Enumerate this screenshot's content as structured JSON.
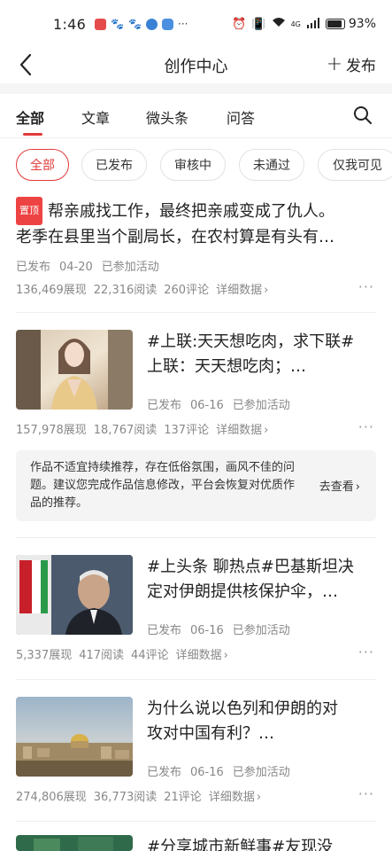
{
  "status_bar": {
    "time": "1:46",
    "notification_more": "···",
    "network": "4G",
    "battery_pct": "93%"
  },
  "header": {
    "title": "创作中心",
    "publish_label": "发布"
  },
  "tabs": [
    {
      "label": "全部",
      "active": true
    },
    {
      "label": "文章",
      "active": false
    },
    {
      "label": "微头条",
      "active": false
    },
    {
      "label": "问答",
      "active": false
    }
  ],
  "chips": [
    {
      "label": "全部",
      "active": true
    },
    {
      "label": "已发布",
      "active": false
    },
    {
      "label": "审核中",
      "active": false
    },
    {
      "label": "未通过",
      "active": false
    },
    {
      "label": "仅我可见",
      "active": false
    }
  ],
  "items": [
    {
      "pin_label": "置顶",
      "title_line1": "帮亲戚找工作，最终把亲戚变成了仇人。",
      "title_line2": "老季在县里当个副局长，在农村算是有头有…",
      "status": "已发布",
      "date": "04-20",
      "activity": "已参加活动",
      "views": "136,469展现",
      "reads": "22,316阅读",
      "comments": "260评论",
      "detail": "详细数据"
    },
    {
      "title_line1": "#上联:天天想吃肉，求下联#",
      "title_line2": "上联：天天想吃肉；…",
      "status": "已发布",
      "date": "06-16",
      "activity": "已参加活动",
      "views": "157,978展现",
      "reads": "18,767阅读",
      "comments": "137评论",
      "detail": "详细数据"
    },
    {
      "title_line1": "#上头条 聊热点#巴基斯坦决",
      "title_line2": "定对伊朗提供核保护伞，…",
      "status": "已发布",
      "date": "06-16",
      "activity": "已参加活动",
      "views": "5,337展现",
      "reads": "417阅读",
      "comments": "44评论",
      "detail": "详细数据"
    },
    {
      "title_line1": "为什么说以色列和伊朗的对",
      "title_line2": "攻对中国有利？…",
      "status": "已发布",
      "date": "06-16",
      "activity": "已参加活动",
      "views": "274,806展现",
      "reads": "36,773阅读",
      "comments": "21评论",
      "detail": "详细数据"
    },
    {
      "title_line1": "#分享城市新鲜事#友现没"
    }
  ],
  "notice": {
    "text": "作品不适宜持续推荐，存在低俗氛围，画风不佳的问题。建议您完成作品信息修改，平台会恢复对优质作品的推荐。",
    "link": "去查看"
  },
  "more_dots": "···",
  "colors": {
    "accent": "#e23a3a",
    "text": "#222222",
    "muted": "#888888",
    "notice_bg": "#f4f4f4"
  }
}
